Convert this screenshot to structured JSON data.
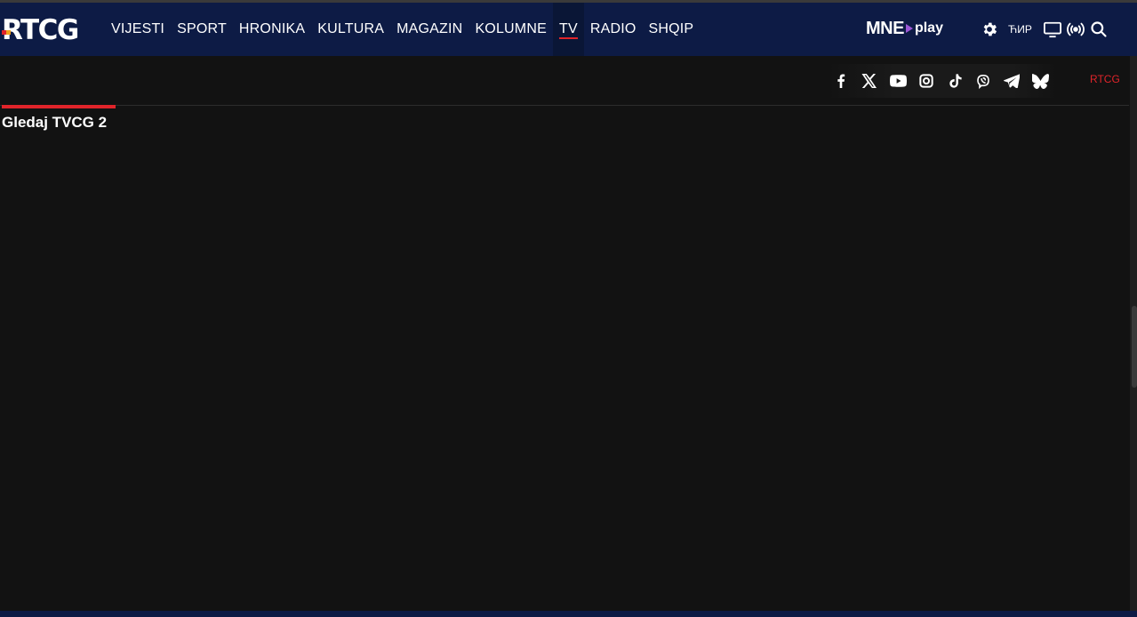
{
  "header": {
    "logo_text": "RTCG",
    "nav": [
      {
        "label": "VIJESTI",
        "active": false
      },
      {
        "label": "SPORT",
        "active": false
      },
      {
        "label": "HRONIKA",
        "active": false
      },
      {
        "label": "KULTURA",
        "active": false
      },
      {
        "label": "MAGAZIN",
        "active": false
      },
      {
        "label": "KOLUMNE",
        "active": false
      },
      {
        "label": "TV",
        "active": true
      },
      {
        "label": "RADIO",
        "active": false
      },
      {
        "label": "SHQIP",
        "active": false
      }
    ],
    "mneplay": {
      "mne": "MNE",
      "play": "play"
    },
    "cyrillic_toggle": "ЋИР",
    "icons": [
      "gear-icon",
      "tv-icon",
      "broadcast-icon",
      "search-icon"
    ]
  },
  "social": {
    "icons": [
      "facebook-icon",
      "x-icon",
      "youtube-icon",
      "instagram-icon",
      "tiktok-icon",
      "viber-icon",
      "telegram-icon",
      "bluesky-icon"
    ],
    "rtcg_link": "RTCG"
  },
  "main": {
    "section_title": "Gledaj TVCG 2"
  },
  "colors": {
    "nav_bg": "#0d1b45",
    "page_bg": "#121212",
    "accent": "#e0242a",
    "play_accent": "#9b57d6"
  }
}
